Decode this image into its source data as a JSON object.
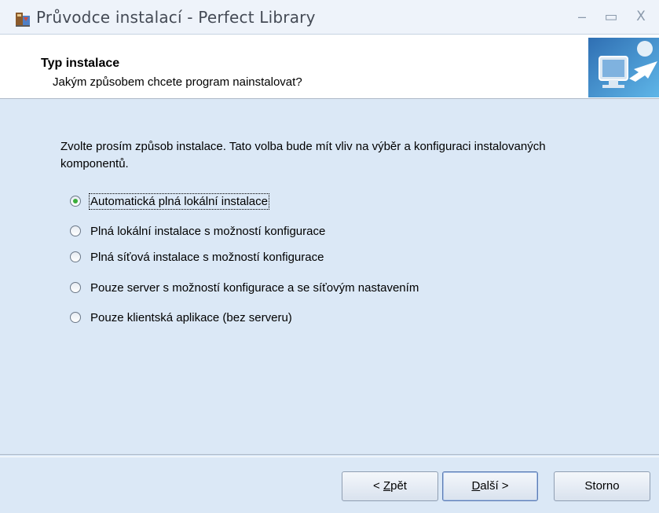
{
  "window": {
    "title": "Průvodce instalací - Perfect Library",
    "min_glyph": "–",
    "max_glyph": "▭",
    "close_glyph": "X"
  },
  "header": {
    "title": "Typ instalace",
    "subtitle": "Jakým způsobem chcete program nainstalovat?"
  },
  "main": {
    "description": "Zvolte prosím způsob instalace. Tato volba bude mít vliv na výběr a konfiguraci instalovaných komponentů.",
    "options": [
      {
        "label": "Automatická plná lokální instalace",
        "checked": true
      },
      {
        "label": "Plná lokální instalace s možností konfigurace",
        "checked": false
      },
      {
        "label": "Plná síťová instalace s možností konfigurace",
        "checked": false
      },
      {
        "label": "Pouze server s možností konfigurace a se síťovým nastavením",
        "checked": false
      },
      {
        "label": "Pouze klientská aplikace (bez serveru)",
        "checked": false
      }
    ]
  },
  "buttons": {
    "back": {
      "prefix": "< ",
      "mnemonic": "Z",
      "rest": "pět"
    },
    "next": {
      "mnemonic": "D",
      "rest": "alší >"
    },
    "cancel": "Storno"
  },
  "colors": {
    "background": "#dbe8f6",
    "radio_checked": "#3bae3b"
  },
  "icons": [
    "installer-app-icon",
    "computer-arrow-header-icon",
    "minimize-icon",
    "maximize-icon",
    "close-icon",
    "radio-checked-icon",
    "radio-unchecked-icon"
  ]
}
